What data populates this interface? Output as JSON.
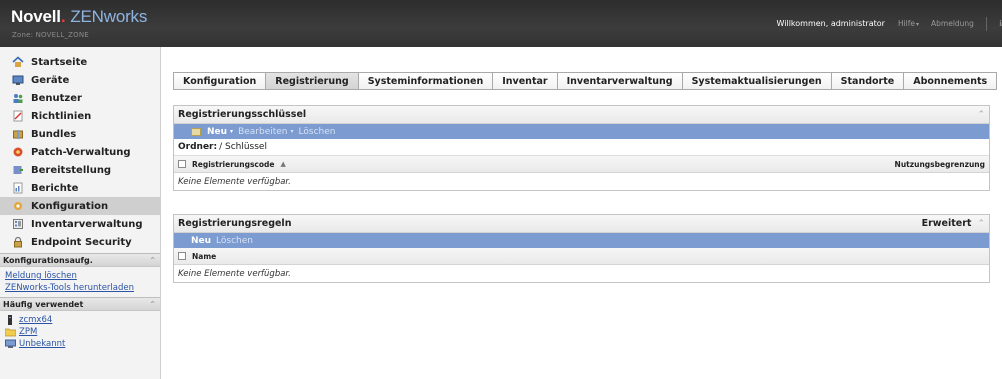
{
  "header": {
    "brand_novell": "Novell",
    "brand_dot": ".",
    "brand_product": "ZENworks",
    "zone": "Zone: NOVELL_ZONE",
    "welcome": "Willkommen, administrator",
    "help": "Hilfe",
    "logout": "Abmeldung",
    "edge": "ℹ"
  },
  "sidebar": {
    "nav": [
      {
        "label": "Startseite",
        "icon": "home-icon"
      },
      {
        "label": "Geräte",
        "icon": "monitor-icon"
      },
      {
        "label": "Benutzer",
        "icon": "users-icon"
      },
      {
        "label": "Richtlinien",
        "icon": "policy-icon"
      },
      {
        "label": "Bundles",
        "icon": "bundles-icon"
      },
      {
        "label": "Patch-Verwaltung",
        "icon": "patch-icon"
      },
      {
        "label": "Bereitstellung",
        "icon": "deployment-icon"
      },
      {
        "label": "Berichte",
        "icon": "reports-icon"
      },
      {
        "label": "Konfiguration",
        "icon": "configuration-icon",
        "active": true
      },
      {
        "label": "Inventarverwaltung",
        "icon": "inventory-icon"
      },
      {
        "label": "Endpoint Security",
        "icon": "lock-icon"
      }
    ],
    "config_tasks": {
      "title": "Konfigurationsaufg.",
      "links": [
        "Meldung löschen",
        "ZENworks-Tools herunterladen"
      ]
    },
    "frequent": {
      "title": "Häufig verwendet",
      "items": [
        {
          "label": "zcmx64",
          "icon": "server-icon"
        },
        {
          "label": "ZPM",
          "icon": "folder-icon"
        },
        {
          "label": "Unbekannt",
          "icon": "workstation-icon"
        }
      ]
    }
  },
  "tabs": [
    {
      "label": "Konfiguration"
    },
    {
      "label": "Registrierung",
      "active": true
    },
    {
      "label": "Systeminformationen"
    },
    {
      "label": "Inventar"
    },
    {
      "label": "Inventarverwaltung"
    },
    {
      "label": "Systemaktualisierungen"
    },
    {
      "label": "Standorte"
    },
    {
      "label": "Abonnements"
    }
  ],
  "keys_panel": {
    "title": "Registrierungsschlüssel",
    "toolbar": {
      "new": "Neu",
      "edit": "Bearbeiten",
      "delete": "Löschen"
    },
    "folder_label": "Ordner:",
    "folder_value": "/ Schlüssel",
    "col_code": "Registrierungscode",
    "col_limit": "Nutzungsbegrenzung",
    "empty": "Keine Elemente verfügbar."
  },
  "rules_panel": {
    "title": "Registrierungsregeln",
    "advanced": "Erweitert",
    "toolbar": {
      "new": "Neu",
      "delete": "Löschen"
    },
    "col_name": "Name",
    "empty": "Keine Elemente verfügbar."
  },
  "colors": {
    "toolbar_blue": "#7c9bd1",
    "link_blue": "#2b54a6",
    "header_dark": "#333333"
  }
}
